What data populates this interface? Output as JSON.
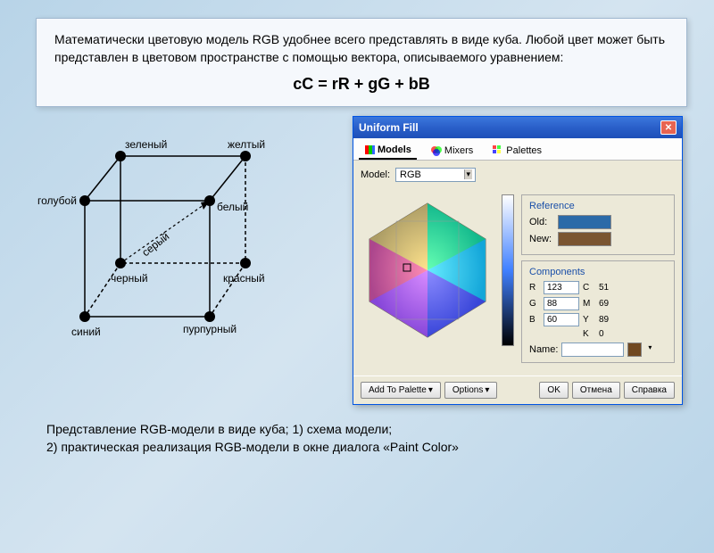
{
  "intro": "Математически цветовую модель RGB удобнее всего представлять в виде куба. Любой цвет может быть представлен в цветовом пространстве с помощью вектора, описываемого уравнением:",
  "equation": "cC = rR + gG + bB",
  "cube_labels": {
    "green": "зеленый",
    "yellow": "желтый",
    "cyan": "голубой",
    "white": "белый",
    "grey": "серый",
    "black": "черный",
    "red": "красный",
    "blue": "синий",
    "magenta": "пурпурный"
  },
  "dialog": {
    "title": "Uniform Fill",
    "tabs": {
      "active": "Models",
      "t2": "Mixers",
      "t3": "Palettes"
    },
    "model_label": "Model:",
    "model_value": "RGB",
    "reference": {
      "title": "Reference",
      "old": "Old:",
      "new": "New:",
      "old_color": "#2b6aa8",
      "new_color": "#7a5530"
    },
    "components": {
      "title": "Components",
      "R": "123",
      "G": "88",
      "B": "60",
      "C": "51",
      "M": "69",
      "Y": "89",
      "K": "0"
    },
    "name_label": "Name:",
    "buttons": {
      "add": "Add To Palette",
      "options": "Options",
      "ok": "OK",
      "cancel": "Отмена",
      "help": "Справка"
    }
  },
  "caption_line1": "Представление RGB-модели в виде куба; 1) схема модели;",
  "caption_line2": "2) практическая реализация RGB-модели в окне диалога «Paint Color»"
}
